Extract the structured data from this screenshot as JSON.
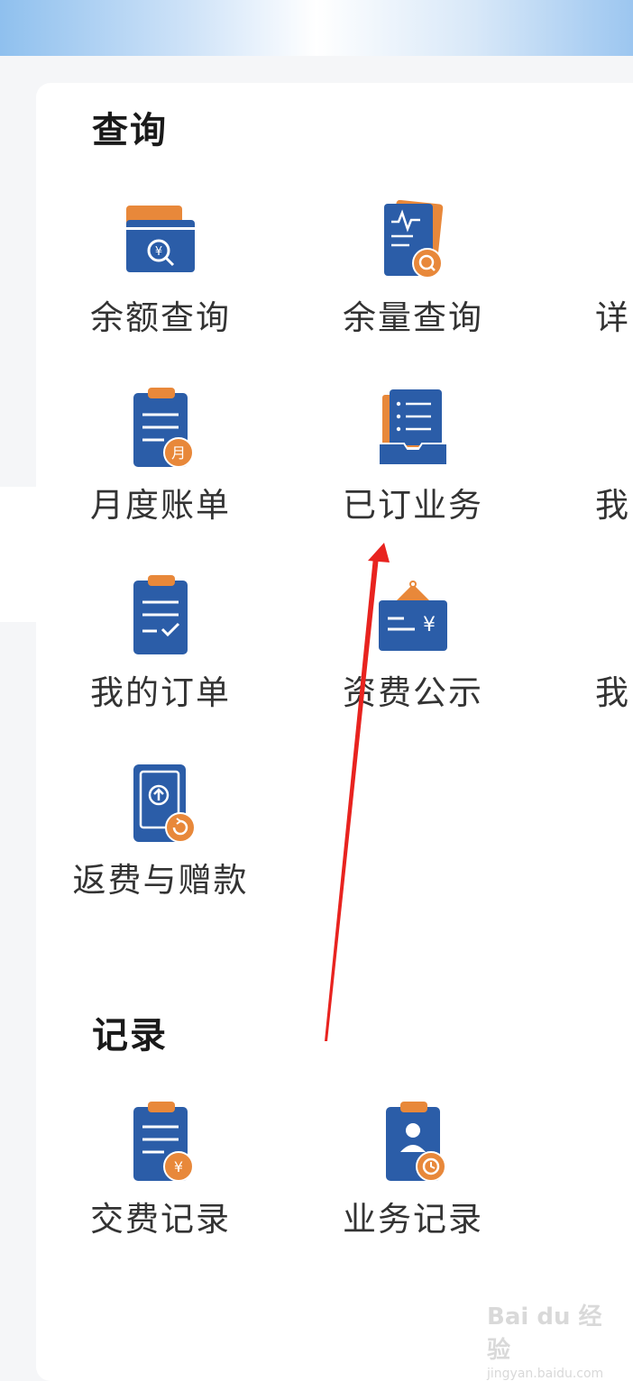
{
  "colors": {
    "primary_blue": "#2b5da8",
    "accent_orange": "#e8883a",
    "text": "#333333",
    "arrow": "#e8231f"
  },
  "sections": [
    {
      "title": "查询"
    },
    {
      "title": "记录"
    }
  ],
  "query_items": [
    {
      "label": "余额查询",
      "icon": "wallet-search-icon"
    },
    {
      "label": "余量查询",
      "icon": "usage-report-icon"
    },
    {
      "label": "详",
      "icon": "detail-icon"
    },
    {
      "label": "月度账单",
      "icon": "monthly-bill-icon"
    },
    {
      "label": "已订业务",
      "icon": "subscribed-services-icon"
    },
    {
      "label": "我",
      "icon": "partial-icon"
    },
    {
      "label": "我的订单",
      "icon": "my-orders-icon"
    },
    {
      "label": "资费公示",
      "icon": "tariff-notice-icon"
    },
    {
      "label": "我",
      "icon": "partial-icon"
    },
    {
      "label": "返费与赠款",
      "icon": "refund-phone-icon"
    }
  ],
  "record_items": [
    {
      "label": "交费记录",
      "icon": "payment-record-icon"
    },
    {
      "label": "业务记录",
      "icon": "service-record-icon"
    }
  ],
  "watermark": {
    "main": "Bai du 经验",
    "sub": "jingyan.baidu.com"
  }
}
